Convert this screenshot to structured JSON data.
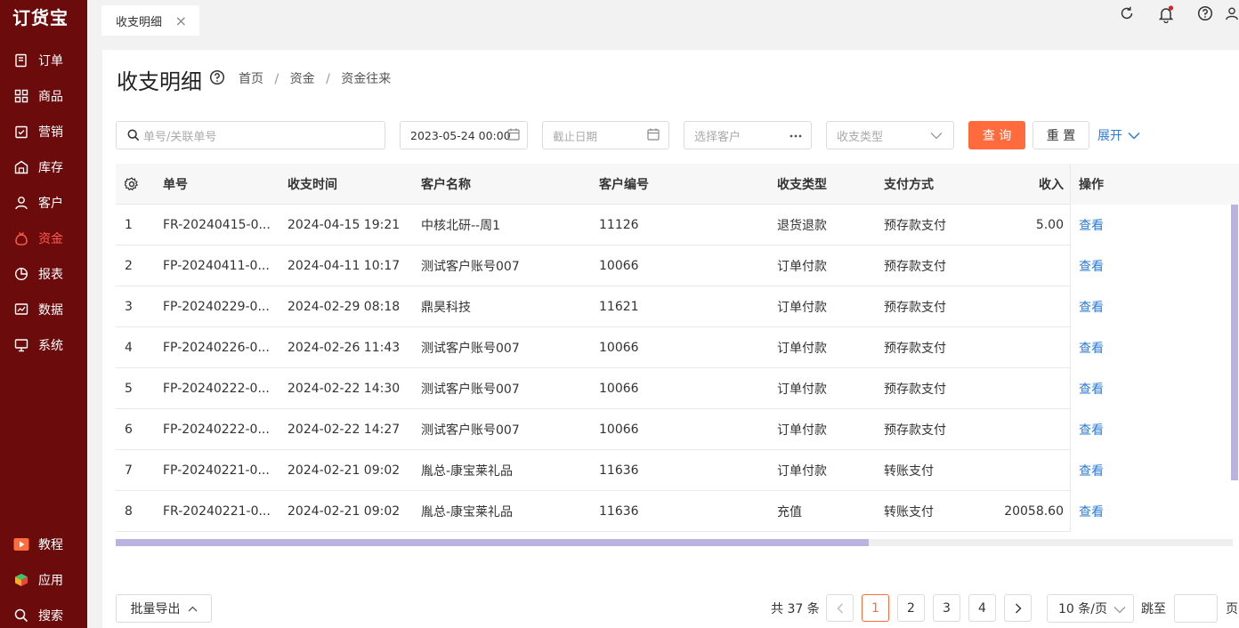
{
  "app": {
    "logo": "订货宝"
  },
  "sidebar": {
    "items": [
      {
        "label": "订单",
        "icon": "order-icon"
      },
      {
        "label": "商品",
        "icon": "product-icon"
      },
      {
        "label": "营销",
        "icon": "marketing-icon"
      },
      {
        "label": "库存",
        "icon": "warehouse-icon"
      },
      {
        "label": "客户",
        "icon": "customer-icon"
      },
      {
        "label": "资金",
        "icon": "funds-icon",
        "active": true
      },
      {
        "label": "报表",
        "icon": "report-icon"
      },
      {
        "label": "数据",
        "icon": "data-icon"
      },
      {
        "label": "系统",
        "icon": "system-icon"
      }
    ],
    "bottom": [
      {
        "label": "教程",
        "icon": "tutorial-icon"
      },
      {
        "label": "应用",
        "icon": "apps-icon"
      },
      {
        "label": "搜索",
        "icon": "search-icon"
      }
    ]
  },
  "tabs": [
    {
      "label": "收支明细",
      "close": "×"
    }
  ],
  "header": {
    "icons": [
      "refresh-icon",
      "bell-icon",
      "help-icon",
      "user-icon"
    ],
    "accent": "#ff6b3d",
    "link_color": "#2b7bd9",
    "sidebar_color": "#6b0b0b"
  },
  "page": {
    "title": "收支明细",
    "breadcrumb": [
      "首页",
      "资金",
      "资金往来"
    ],
    "breadcrumb_sep": "/"
  },
  "filters": {
    "search_placeholder": "单号/关联单号",
    "start_date": "2023-05-24 00:00",
    "end_date_placeholder": "截止日期",
    "customer_placeholder": "选择客户",
    "type_placeholder": "收支类型",
    "query_label": "查 询",
    "reset_label": "重 置",
    "expand_label": "展开"
  },
  "table": {
    "columns": {
      "no": "单号",
      "time": "收支时间",
      "customer": "客户名称",
      "code": "客户编号",
      "type": "收支类型",
      "pay": "支付方式",
      "income": "收入",
      "op": "操作"
    },
    "rows": [
      {
        "idx": "1",
        "no": "FR-20240415-0...",
        "time": "2024-04-15 19:21",
        "customer": "中核北研--周1",
        "code": "11126",
        "type": "退货退款",
        "pay": "预存款支付",
        "income": "5.00",
        "op": "查看"
      },
      {
        "idx": "2",
        "no": "FP-20240411-0...",
        "time": "2024-04-11 10:17",
        "customer": "测试客户账号007",
        "code": "10066",
        "type": "订单付款",
        "pay": "预存款支付",
        "income": "",
        "op": "查看"
      },
      {
        "idx": "3",
        "no": "FP-20240229-0...",
        "time": "2024-02-29 08:18",
        "customer": "鼎昊科技",
        "code": "11621",
        "type": "订单付款",
        "pay": "预存款支付",
        "income": "",
        "op": "查看"
      },
      {
        "idx": "4",
        "no": "FP-20240226-0...",
        "time": "2024-02-26 11:43",
        "customer": "测试客户账号007",
        "code": "10066",
        "type": "订单付款",
        "pay": "预存款支付",
        "income": "",
        "op": "查看"
      },
      {
        "idx": "5",
        "no": "FP-20240222-0...",
        "time": "2024-02-22 14:30",
        "customer": "测试客户账号007",
        "code": "10066",
        "type": "订单付款",
        "pay": "预存款支付",
        "income": "",
        "op": "查看"
      },
      {
        "idx": "6",
        "no": "FP-20240222-0...",
        "time": "2024-02-22 14:27",
        "customer": "测试客户账号007",
        "code": "10066",
        "type": "订单付款",
        "pay": "预存款支付",
        "income": "",
        "op": "查看"
      },
      {
        "idx": "7",
        "no": "FP-20240221-0...",
        "time": "2024-02-21 09:02",
        "customer": "胤总-康宝莱礼品",
        "code": "11636",
        "type": "订单付款",
        "pay": "转账支付",
        "income": "",
        "op": "查看"
      },
      {
        "idx": "8",
        "no": "FR-20240221-0...",
        "time": "2024-02-21 09:02",
        "customer": "胤总-康宝莱礼品",
        "code": "11636",
        "type": "充值",
        "pay": "转账支付",
        "income": "20058.60",
        "op": "查看"
      }
    ]
  },
  "footer": {
    "export_label": "批量导出",
    "total": "共 37 条",
    "pages": [
      "1",
      "2",
      "3",
      "4"
    ],
    "current_page": "1",
    "page_size": "10 条/页",
    "jump_label": "跳至",
    "page_suffix": "页"
  }
}
